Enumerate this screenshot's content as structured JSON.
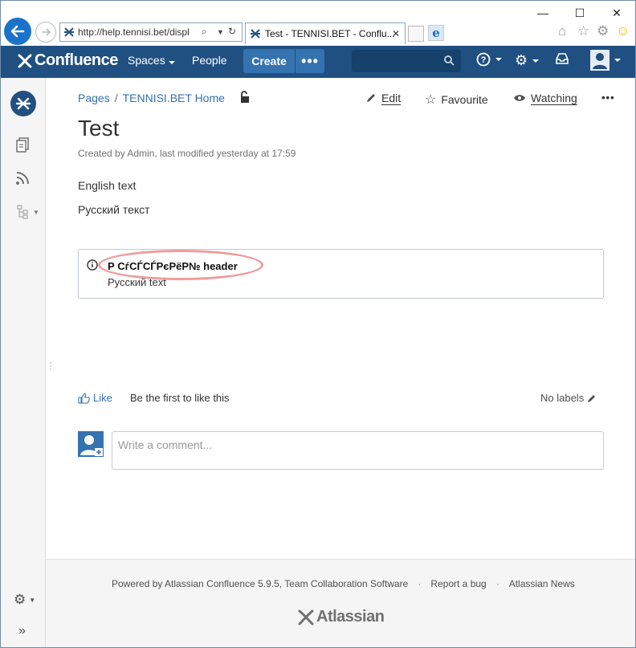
{
  "browser": {
    "address_url": "http://help.tennisi.bet/displ",
    "tab_title": "Test - TENNISI.BET - Conflu...",
    "window_controls": {
      "minimize": "—",
      "maximize": "☐",
      "close": "✕"
    }
  },
  "header": {
    "brand": "Confluence",
    "nav": {
      "spaces": "Spaces",
      "people": "People"
    },
    "create_label": "Create",
    "more_label": "•••"
  },
  "breadcrumb": {
    "pages": "Pages",
    "separator": "/",
    "space": "TENNISI.BET Home"
  },
  "actions": {
    "edit": "Edit",
    "favourite": "Favourite",
    "watching": "Watching",
    "more": "•••"
  },
  "page": {
    "title": "Test",
    "byline": "Created by Admin, last modified yesterday at 17:59",
    "paragraphs": [
      "English text",
      "Русский текст"
    ]
  },
  "info_panel": {
    "header": "Р СѓСЃСЃРєРёР№ header",
    "body": "Русский text"
  },
  "likes": {
    "like": "Like",
    "first": "Be the first to like this",
    "labels": "No labels"
  },
  "comment": {
    "placeholder": "Write a comment..."
  },
  "footer": {
    "powered": "Powered by Atlassian Confluence 5.9.5, Team Collaboration Software",
    "report": "Report a bug",
    "news": "Atlassian News",
    "separator": "·",
    "logo": "Atlassian"
  },
  "colors": {
    "header_bg": "#205081",
    "create_bg": "#3572b0",
    "link": "#3572b0",
    "annotation_ring": "#ef9b9b"
  }
}
